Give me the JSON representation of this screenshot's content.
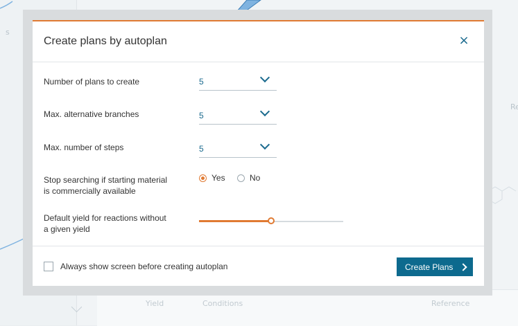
{
  "background": {
    "left_fragment": "s",
    "right_fragment": "Re",
    "table_columns": [
      "Yield",
      "Conditions",
      "Reference"
    ]
  },
  "modal": {
    "title": "Create plans by autoplan",
    "close_symbol": "×",
    "fields": [
      {
        "label": "Number of plans to create",
        "value": "5"
      },
      {
        "label": "Max. alternative branches",
        "value": "5"
      },
      {
        "label": "Max. number of steps",
        "value": "5"
      }
    ],
    "stop_search": {
      "label_line1": "Stop searching if starting material",
      "label_line2": "is commercially available",
      "options": [
        "Yes",
        "No"
      ],
      "selected": "Yes"
    },
    "default_yield": {
      "label_line1": "Default yield for reactions without",
      "label_line2": "a given yield",
      "level_fraction": 0.5
    },
    "footer": {
      "checkbox_label": "Always show screen before creating autoplan",
      "checkbox_checked": false,
      "primary_button": "Create Plans"
    }
  },
  "colors": {
    "accent": "#e07a32",
    "primary": "#0d6a8e",
    "link": "#1a6a8e"
  },
  "icons": [
    "close-icon",
    "chevron-down-icon",
    "chevron-right-icon"
  ]
}
